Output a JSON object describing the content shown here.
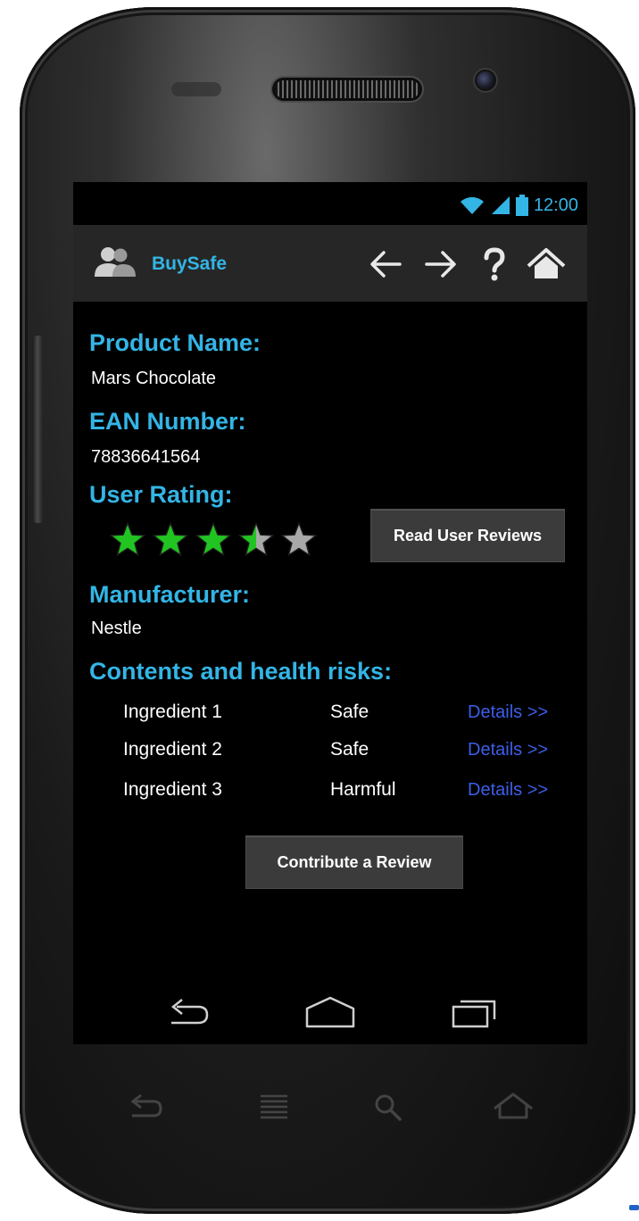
{
  "status_bar": {
    "time": "12:00",
    "icons": [
      "wifi-icon",
      "signal-icon",
      "battery-icon"
    ]
  },
  "action_bar": {
    "app_icon": "users-icon",
    "title": "BuySafe",
    "nav_icons": [
      "back-arrow-icon",
      "forward-arrow-icon",
      "help-icon",
      "home-icon"
    ]
  },
  "product": {
    "name_label": "Product Name:",
    "name_value": "Mars Chocolate",
    "ean_label": "EAN Number:",
    "ean_value": "78836641564",
    "rating_label": "User Rating:",
    "rating_value": 3.5,
    "rating_max": 5,
    "read_reviews_button": "Read User Reviews",
    "manufacturer_label": "Manufacturer:",
    "manufacturer_value": "Nestle",
    "contents_label": "Contents and health risks:"
  },
  "ingredients": [
    {
      "name": "Ingredient 1",
      "status": "Safe",
      "link": "Details >>"
    },
    {
      "name": "Ingredient 2",
      "status": "Safe",
      "link": "Details >>"
    },
    {
      "name": "Ingredient 3",
      "status": "Harmful",
      "link": "Details >>"
    }
  ],
  "contribute_button": "Contribute a Review",
  "colors": {
    "accent": "#33b5e5",
    "link": "#3d5ee8",
    "star_filled": "#22c422",
    "star_empty": "#a8a8a8",
    "background": "#000000",
    "action_bar": "#262626",
    "button": "#3b3b3b"
  },
  "system_nav": [
    "back-icon",
    "home-icon",
    "recent-apps-icon"
  ],
  "hardware_buttons": [
    "back-icon",
    "menu-icon",
    "search-icon",
    "home-icon"
  ]
}
